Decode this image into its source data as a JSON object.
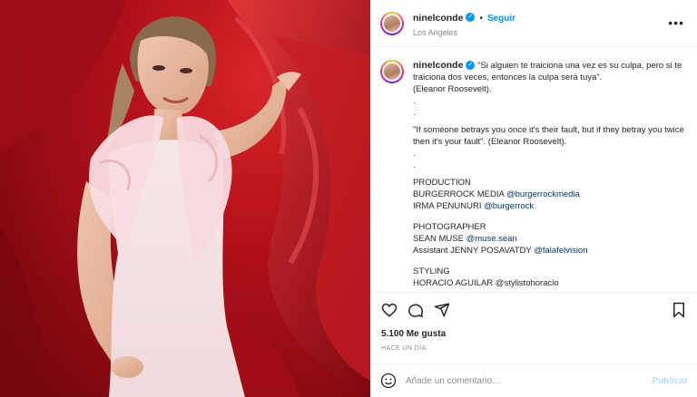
{
  "post": {
    "username": "ninelconde",
    "verified_glyph": "✓",
    "dot": "•",
    "follow_label": "Seguir",
    "location": "Los Angeles",
    "more_icon": "more-horizontal-icon",
    "more_glyph": "•••"
  },
  "caption": {
    "username": "ninelconde",
    "lines": [
      "\"Si alguien te traiciona una vez es su culpa, pero si te traiciona dos veces, entonces la culpa será tuya\".",
      "(Eleanor Roosevelt).",
      ".",
      ".",
      "\"If someone betrays you once it's their fault, but if they betray you twice then it's your fault\". (Eleanor Roosevelt).",
      ".",
      ".",
      "PRODUCTION"
    ],
    "credit1_text": "BURGERROCK MEDIA ",
    "credit1_mention": "@burgerrockmedia",
    "credit2_text": "IRMA PENUNURI ",
    "credit2_mention": "@burgerrock",
    "photographer_heading": "PHOTOGRAPHER",
    "credit3_text": "SEAN MUSE ",
    "credit3_mention": "@muse.sean",
    "credit4_text": "Assistant JENNY POSAVATDY ",
    "credit4_mention": "@falafelvision",
    "styling_heading": "STYLING",
    "cut_line": "HORACIO AGUILAR @stylistohoracio"
  },
  "actions": {
    "icons": [
      "heart-icon",
      "comment-icon",
      "share-icon",
      "bookmark-icon"
    ]
  },
  "likes": "5.100 Me gusta",
  "timestamp": "HACE UN DÍA",
  "comment_box": {
    "emoji_icon": "emoji-icon",
    "placeholder": "Añade un comentario...",
    "publish_label": "Publicar"
  },
  "colors": {
    "link": "#0095f6",
    "mention": "#00376b",
    "background_red": "#b4111a"
  }
}
